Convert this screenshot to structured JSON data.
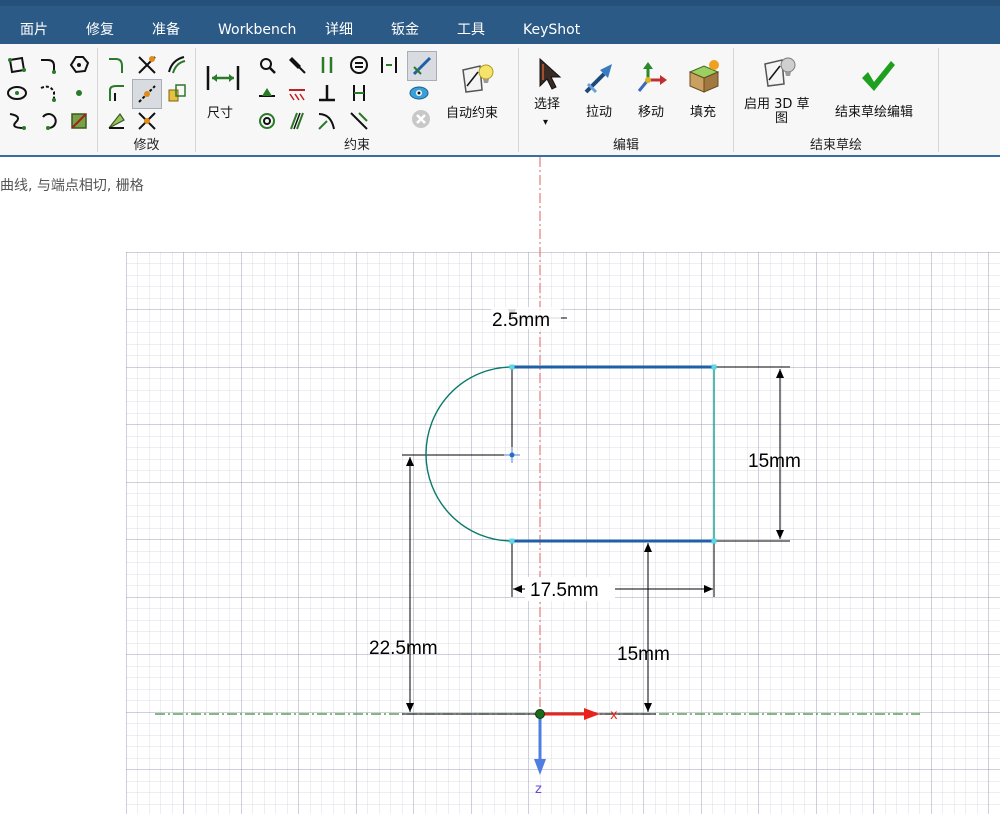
{
  "menu": {
    "tabs": [
      "面片",
      "修复",
      "准备",
      "Workbench",
      "详细",
      "钣金",
      "工具",
      "KeyShot"
    ]
  },
  "ribbon": {
    "groups": {
      "modify": "修改",
      "constraint": "约束",
      "edit": "编辑",
      "finish": "结束草绘"
    },
    "buttons": {
      "dimension": "尺寸",
      "auto_constrain": "自动约束",
      "select": "选择",
      "select_arrow": "▾",
      "pull": "拉动",
      "move": "移动",
      "fill": "填充",
      "enable_3d_line1": "启用 3D 草",
      "enable_3d_line2": "图",
      "end_sketch": "结束草绘编辑"
    }
  },
  "status_hint": "曲线, 与端点相切, 栅格",
  "sketch": {
    "dimensions": {
      "top_offset": "2.5mm",
      "height": "15mm",
      "width": "17.5mm",
      "center_height": "22.5mm",
      "bottom_height": "15mm"
    },
    "axis_labels": {
      "x": "x",
      "z": "z"
    }
  },
  "colors": {
    "title_bar": "#2c5a86",
    "edge_selected": "#1f5fa8",
    "edge_normal": "#0a7a6a",
    "axis_x": "#e8231a",
    "axis_z": "#4f7ee0",
    "horizontal_axis": "#3a8f3a",
    "vertical_axis": "#e06060"
  }
}
